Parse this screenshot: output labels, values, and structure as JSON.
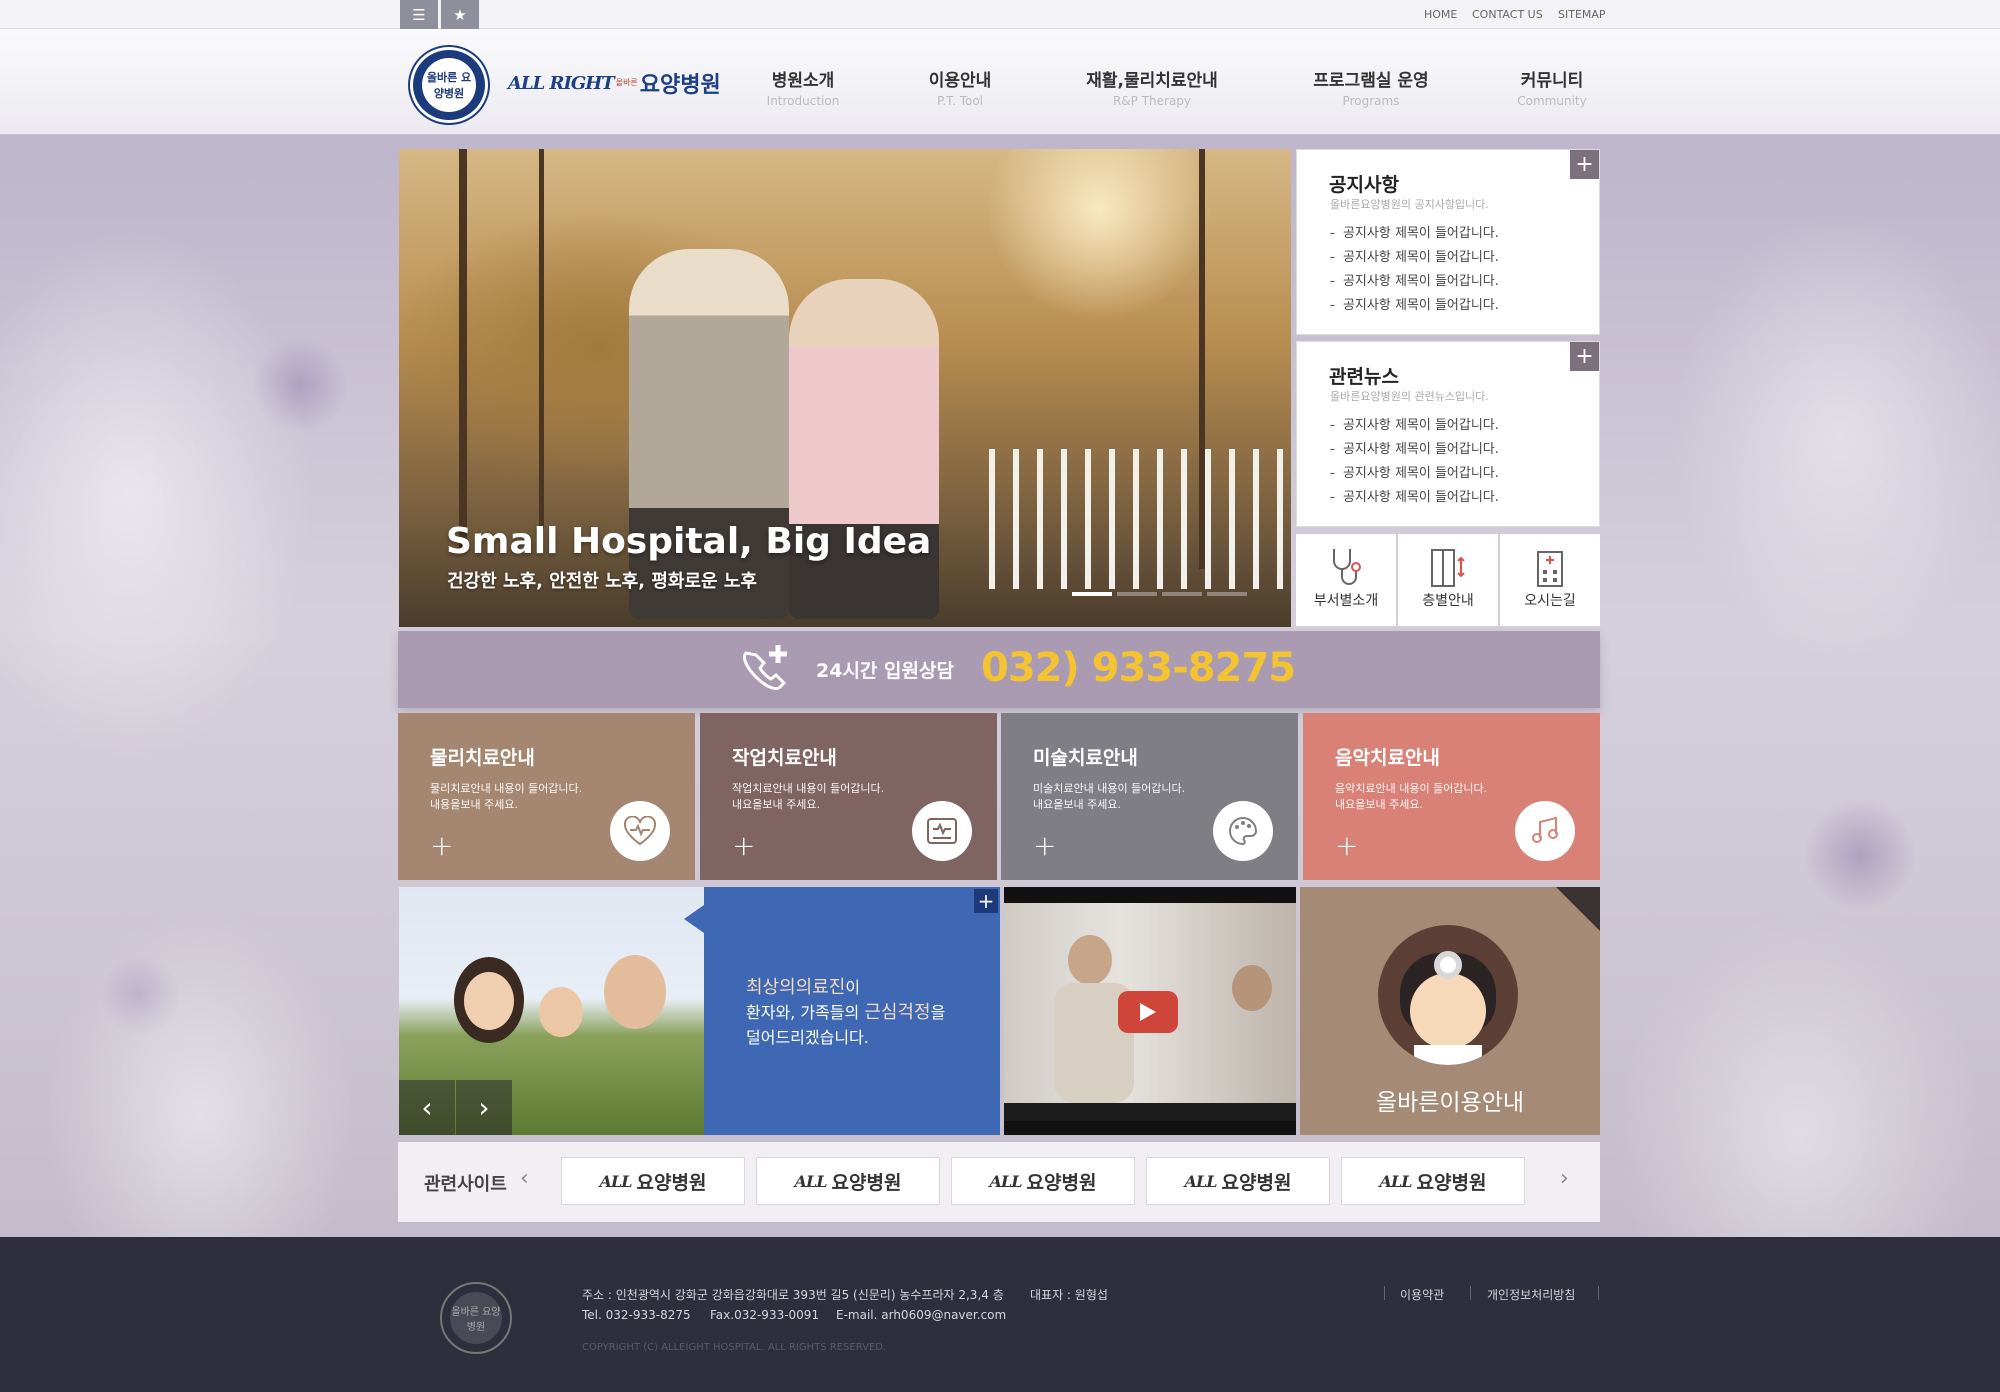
{
  "topbar": {
    "links": [
      "HOME",
      "CONTACT US",
      "SITEMAP"
    ]
  },
  "header": {
    "seal_text": "올바른 요양병원",
    "seal_ring_top": "ALL",
    "seal_ring_bottom": "RIGHT",
    "brand_en": "ALL RIGHT",
    "brand_small": "올바른",
    "brand_ko": "요양병원",
    "nav": [
      {
        "ko": "병원소개",
        "en": "Introduction"
      },
      {
        "ko": "이용안내",
        "en": "P.T. Tool"
      },
      {
        "ko": "재활,물리치료안내",
        "en": "R&P Therapy"
      },
      {
        "ko": "프로그램실 운영",
        "en": "Programs"
      },
      {
        "ko": "커뮤니티",
        "en": "Community"
      }
    ]
  },
  "slider": {
    "title": "Small Hospital, Big Idea",
    "subtitle": "건강한 노후, 안전한 노후, 평화로운 노후",
    "active_index": 0,
    "slide_count": 4
  },
  "notice": {
    "title": "공지사항",
    "desc": "올바른요양병원의 공지사항입니다.",
    "items": [
      "공지사항 제목이 들어갑니다.",
      "공지사항 제목이 들어갑니다.",
      "공지사항 제목이 들어갑니다.",
      "공지사항 제목이 들어갑니다."
    ]
  },
  "news": {
    "title": "관련뉴스",
    "desc": "올바른요양병원의 관련뉴스입니다.",
    "items": [
      "공지사항 제목이 들어갑니다.",
      "공지사항 제목이 들어갑니다.",
      "공지사항 제목이 들어갑니다.",
      "공지사항 제목이 들어갑니다."
    ]
  },
  "quick": [
    {
      "label": "부서별소개",
      "icon": "stethoscope-icon"
    },
    {
      "label": "층별안내",
      "icon": "door-icon"
    },
    {
      "label": "오시는길",
      "icon": "building-icon"
    }
  ],
  "phone": {
    "label": "24시간 입원상담",
    "number": "032) 933-8275"
  },
  "therapy": [
    {
      "title": "물리치료안내",
      "line1": "물리치료안내 내용이 들어갑니다.",
      "line2": "내용을보내 주세요.",
      "color": "#a58671",
      "icon": "heart-icon"
    },
    {
      "title": "작업치료안내",
      "line1": "작업치료안내 내용이 들어갑니다.",
      "line2": "내요을보내 주세요.",
      "color": "#806462",
      "icon": "monitor-icon"
    },
    {
      "title": "미술치료안내",
      "line1": "미술치료안내 내용이 들어갑니다.",
      "line2": "내요을보내 주세요.",
      "color": "#7f7e84",
      "icon": "palette-icon"
    },
    {
      "title": "음악치료안내",
      "line1": "음악치료안내 내용이 들어갑니다.",
      "line2": "내요을보내 주세요.",
      "color": "#d98177",
      "icon": "music-icon"
    }
  ],
  "promo": {
    "hl1": "최상의의료진",
    "t1": "이",
    "t2": "환자와, 가족들의 ",
    "hl2": "근심걱정",
    "t3": "을",
    "t4": "덜어드리겠습니다."
  },
  "guide": {
    "label": "올바른이용안내"
  },
  "related": {
    "title": "관련사이트",
    "logos": [
      "요양병원",
      "요양병원",
      "요양병원",
      "요양병원",
      "요양병원"
    ]
  },
  "footer": {
    "address": "주소 : 인천광역시 강화군 강화읍강화대로 393번 길5 (신문리) 농수프라자 2,3,4 층",
    "ceo": "대표자 : 원형섭",
    "tel": "Tel. 032-933-8275",
    "fax": "Fax.032-933-0091",
    "email": "E-mail.  arh0609@naver.com",
    "copyright": "COPYRIGHT (C)  ALLEIGHT HOSPITAL. ALL RIGHTS RESERVED.",
    "terms": "이용약관",
    "privacy": "개인정보처리방침",
    "seal_text": "올바른 요양병원"
  }
}
